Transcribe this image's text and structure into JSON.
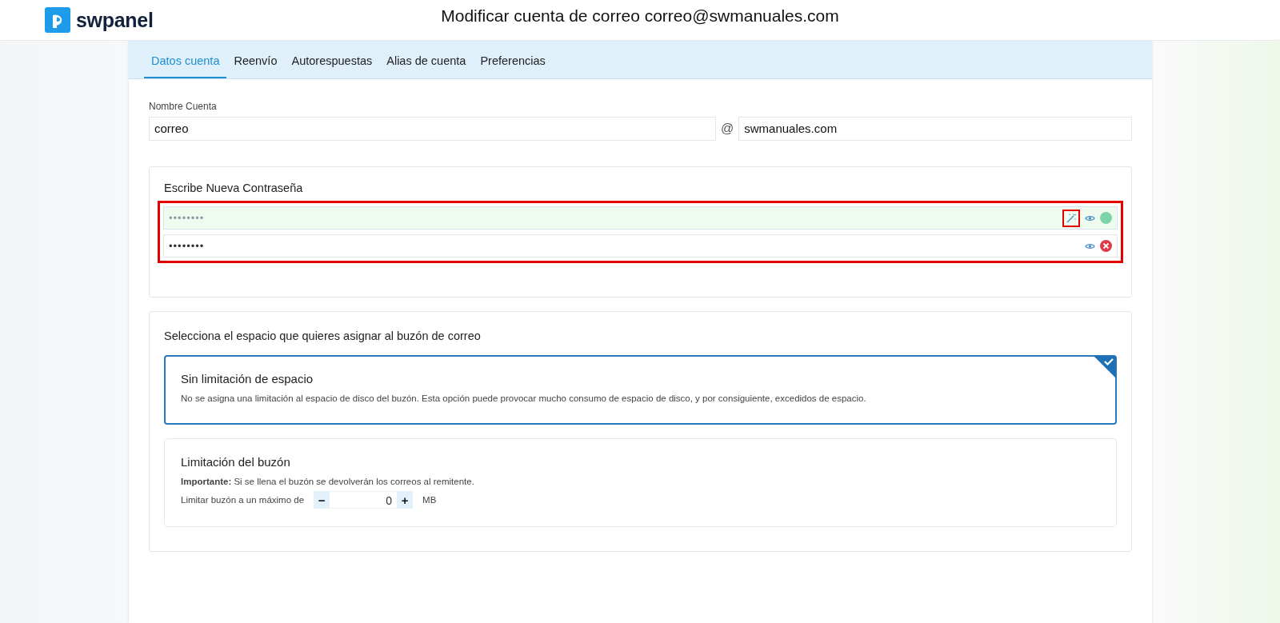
{
  "header": {
    "brand": "swpanel",
    "title": "Modificar cuenta de correo correo@swmanuales.com"
  },
  "tabs": [
    {
      "label": "Datos cuenta",
      "selected": true
    },
    {
      "label": "Reenvío",
      "selected": false
    },
    {
      "label": "Autorespuestas",
      "selected": false
    },
    {
      "label": "Alias de cuenta",
      "selected": false
    },
    {
      "label": "Preferencias",
      "selected": false
    }
  ],
  "account": {
    "label": "Nombre Cuenta",
    "value": "correo",
    "at": "@",
    "domain": "swmanuales.com"
  },
  "password": {
    "title": "Escribe Nueva Contraseña",
    "highlighted": true,
    "fields": [
      {
        "placeholder": "••••••••",
        "generator": true,
        "generator_highlighted": true,
        "valid": true
      },
      {
        "value": "••••••••",
        "generator": false,
        "valid": false
      }
    ]
  },
  "space": {
    "title": "Selecciona el espacio que quieres asignar al buzón de correo",
    "options": [
      {
        "kind": "plain",
        "title": "Sin limitación de espacio",
        "text": "No se asigna una limitación al espacio de disco del buzón. Esta opción puede provocar mucho consumo de espacio de disco, y por consiguiente, excedidos de espacio.",
        "selected": true
      },
      {
        "kind": "limit",
        "title": "Limitación del buzón",
        "text": "**Importante:** Si se llena el buzón se devolverán los correos al remitente.",
        "limit_label": "Limitar buzón a un máximo de",
        "minus": "−",
        "value": "0",
        "plus": "+",
        "unit": "MB",
        "selected": false
      }
    ]
  }
}
